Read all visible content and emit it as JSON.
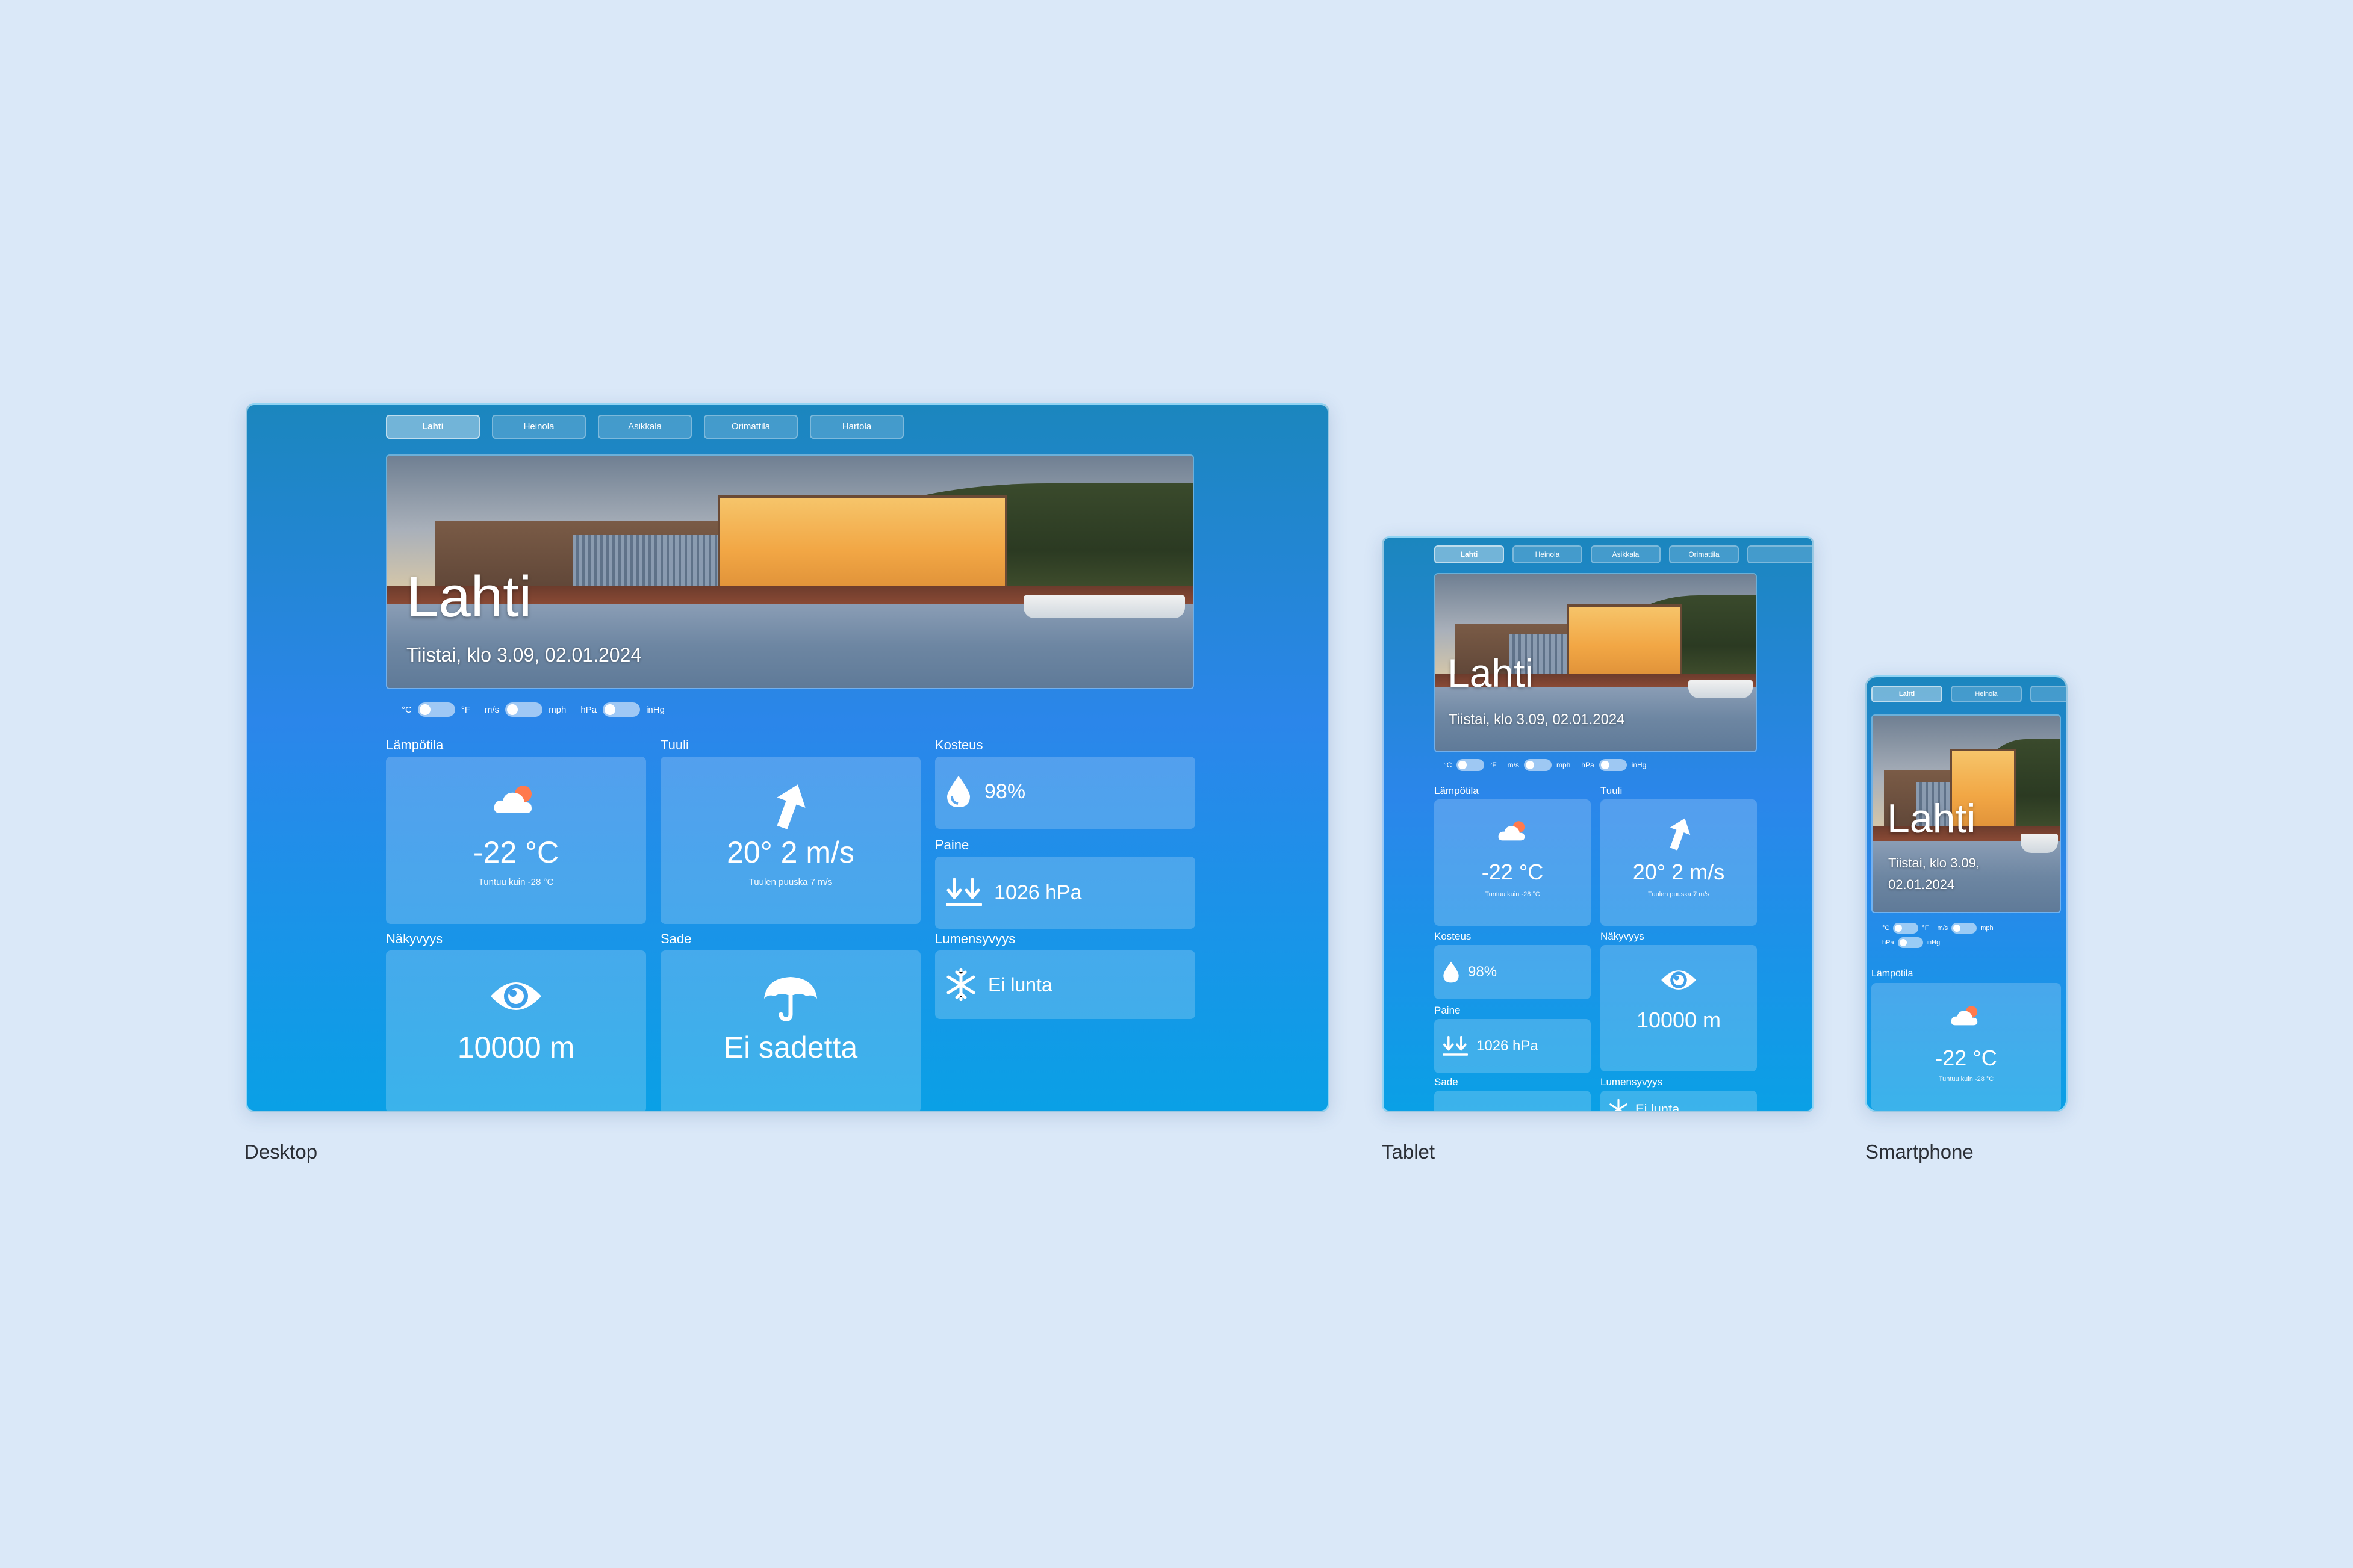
{
  "tabs": [
    "Lahti",
    "Heinola",
    "Asikkala",
    "Orimattila",
    "Hartola"
  ],
  "hero": {
    "city": "Lahti",
    "date": "Tiistai, klo 3.09, 02.01.2024",
    "date_line1": "Tiistai, klo 3.09,",
    "date_line2": "02.01.2024"
  },
  "units": {
    "temp_left": "°C",
    "temp_right": "°F",
    "wind_left": "m/s",
    "wind_right": "mph",
    "press_left": "hPa",
    "press_right": "inHg"
  },
  "sections": {
    "temperature": "Lämpötila",
    "wind": "Tuuli",
    "humidity": "Kosteus",
    "pressure": "Paine",
    "visibility": "Näkyvyys",
    "rain": "Sade",
    "snow": "Lumensyvyys"
  },
  "values": {
    "temperature": "-22 °C",
    "feels_like": "Tuntuu kuin -28 °C",
    "wind": "20° 2 m/s",
    "gust": "Tuulen puuska 7 m/s",
    "humidity": "98%",
    "pressure": "1026 hPa",
    "visibility": "10000 m",
    "rain": "Ei sadetta",
    "snow": "Ei lunta",
    "snow_cut": "Ei lunta"
  },
  "captions": {
    "desktop": "Desktop",
    "tablet": "Tablet",
    "phone": "Smartphone"
  },
  "icons": {
    "weather": "cloud-sun-icon",
    "wind": "arrow-up-right-icon",
    "humidity": "droplet-icon",
    "pressure": "arrows-down-icon",
    "visibility": "eye-icon",
    "rain": "umbrella-icon",
    "snow": "snowflake-icon"
  },
  "colors": {
    "page_bg": "#dae8f8",
    "sun": "#ff7a4d"
  }
}
